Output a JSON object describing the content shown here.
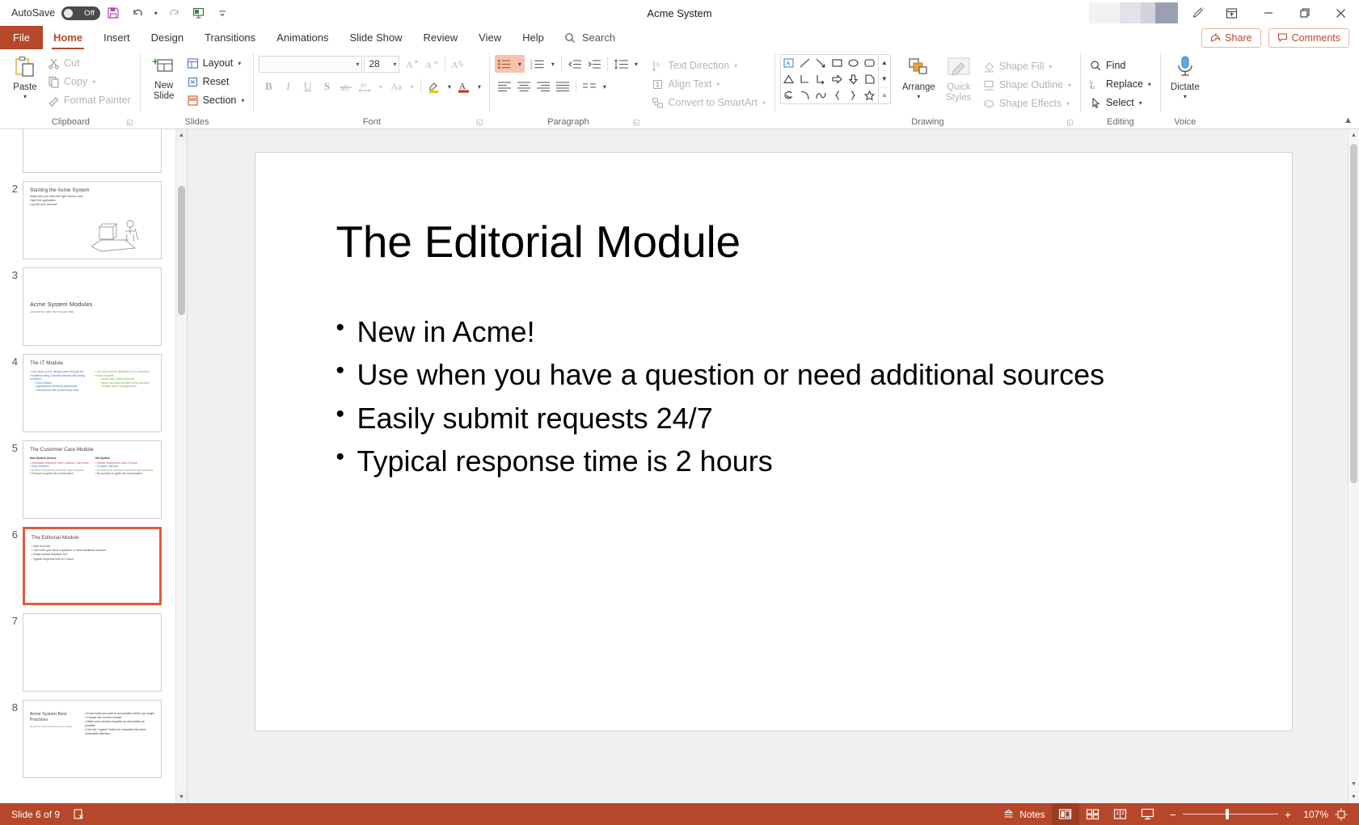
{
  "window": {
    "title": "Acme System",
    "autosave_label": "AutoSave",
    "autosave_state": "Off",
    "minimize": "Minimize",
    "restore": "Restore",
    "close": "Close"
  },
  "quick_access": {
    "save": "save-icon",
    "undo": "undo-icon",
    "redo": "redo-icon",
    "start_slideshow": "slideshow-icon",
    "customize": "customize-qat-icon"
  },
  "tabs": [
    {
      "label": "File",
      "active": false,
      "file": true
    },
    {
      "label": "Home",
      "active": true
    },
    {
      "label": "Insert",
      "active": false
    },
    {
      "label": "Design",
      "active": false
    },
    {
      "label": "Transitions",
      "active": false
    },
    {
      "label": "Animations",
      "active": false
    },
    {
      "label": "Slide Show",
      "active": false
    },
    {
      "label": "Review",
      "active": false
    },
    {
      "label": "View",
      "active": false
    },
    {
      "label": "Help",
      "active": false
    }
  ],
  "search": {
    "label": "Search"
  },
  "titlebar_actions": {
    "share": "Share",
    "comments": "Comments",
    "ribbon_display": "ribbon-display-options-icon",
    "pen": "pen-icon"
  },
  "ribbon": {
    "collapse": "∧",
    "groups": {
      "clipboard": {
        "label": "Clipboard",
        "paste": "Paste",
        "cut": "Cut",
        "copy": "Copy",
        "format_painter": "Format Painter"
      },
      "slides": {
        "label": "Slides",
        "new_slide": "New\nSlide",
        "new_slide_l1": "New",
        "new_slide_l2": "Slide",
        "layout": "Layout",
        "reset": "Reset",
        "section": "Section"
      },
      "font": {
        "label": "Font",
        "font_name": "",
        "font_size": "28",
        "grow": "Increase Font Size",
        "shrink": "Decrease Font Size",
        "clear_formatting": "Clear All Formatting",
        "bold": "B",
        "italic": "I",
        "underline": "U",
        "shadow": "S",
        "strikethrough": "Strikethrough",
        "char_spacing": "Character Spacing",
        "change_case": "Aa",
        "highlight": "Text Highlight Color",
        "font_color": "Font Color"
      },
      "paragraph": {
        "label": "Paragraph",
        "bullets": "Bullets",
        "numbering": "Numbering",
        "decrease_indent": "Decrease List Level",
        "increase_indent": "Increase List Level",
        "line_spacing": "Line Spacing",
        "text_direction": "Text Direction",
        "align_text": "Align Text",
        "convert_smartart": "Convert to SmartArt",
        "align_left": "Align Left",
        "align_center": "Center",
        "align_right": "Align Right",
        "justify": "Justify",
        "columns": "Columns"
      },
      "drawing": {
        "label": "Drawing",
        "arrange": "Arrange",
        "quick_styles_l1": "Quick",
        "quick_styles_l2": "Styles",
        "shape_fill": "Shape Fill",
        "shape_outline": "Shape Outline",
        "shape_effects": "Shape Effects",
        "shapes": [
          "text-box-shape",
          "line-shape",
          "arrow-shape",
          "rectangle-shape",
          "oval-shape",
          "rounded-rectangle-shape",
          "triangle-shape",
          "elbow-connector-shape",
          "elbow-arrow-shape",
          "right-arrow-shape",
          "down-arrow-shape",
          "pentagon-shape",
          "scribble-shape",
          "arc-shape",
          "curve-shape",
          "left-brace-shape",
          "right-brace-shape",
          "star-shape"
        ]
      },
      "editing": {
        "label": "Editing",
        "find": "Find",
        "replace": "Replace",
        "select": "Select"
      },
      "voice": {
        "label": "Voice",
        "dictate": "Dictate"
      }
    }
  },
  "thumbnails": [
    {
      "number": "",
      "selected": false,
      "partial_top": true,
      "title": "",
      "bullets": []
    },
    {
      "number": "2",
      "selected": false,
      "title": "Starting the Acme System",
      "bullets": [
        "Make sure you have the right access code",
        "Open the application",
        "Log into your account"
      ],
      "has_image": true
    },
    {
      "number": "3",
      "selected": false,
      "title": "Acme System Modules",
      "subtitle": "Choose the right one for your task",
      "centered": true,
      "bullets": []
    },
    {
      "number": "4",
      "selected": false,
      "title": "The IT Module",
      "two_col": true,
      "left_items": [
        "Use when you've already gone through the Troubleshooting Checklist and are still having problems:",
        "Slow system",
        "Applications behaving abnormally",
        "Interference with AcmePhone calls"
      ],
      "right_items": [
        "Use when you're following up on a previous service request:",
        "Issue hasn't been resolved",
        "Issue has returned after being resolved",
        "Related issue has appeared"
      ],
      "left_color": "#4472c4",
      "right_color": "#70ad47"
    },
    {
      "number": "5",
      "selected": false,
      "title": "The Customer Care Module",
      "two_col": true,
      "left_header": "New System (Acme)",
      "right_header": "Old System",
      "left_items": [
        "Immediate response from Customer Care team",
        "Easy interface",
        "Access to previous customer care sessions",
        "Prompts to guide the conversation"
      ],
      "right_items": [
        "Submit request and wait 24 hours",
        "Complex interface",
        "No access to previous customer care sessions",
        "No prompts to guide the conversation"
      ],
      "item_colors": [
        "#c0504d",
        "#4472c4",
        "#70ad47",
        "#7030a0"
      ]
    },
    {
      "number": "6",
      "selected": true,
      "title": "The Editorial Module",
      "bullets": [
        "New in Acme!",
        "Use when you have a question or need additional sources",
        "Easily submit requests 24/7",
        "Typical response time is 2 hours"
      ]
    },
    {
      "number": "7",
      "selected": false,
      "title": "",
      "bullets": []
    },
    {
      "number": "8",
      "selected": false,
      "title": "Acme System Best Practices",
      "subtitle": "Read and understand before you begin",
      "two_col": true,
      "right_items": [
        "Know what you want to accomplish before you begin",
        "Choose the correct module",
        "Make your service requests as descriptive as possible",
        "Use the \"urgent\" button for requests that need immediate attention"
      ]
    }
  ],
  "slide": {
    "title": "The Editorial Module",
    "bullets": [
      "New in Acme!",
      "Use when you have a question or need additional sources",
      "Easily submit requests 24/7",
      "Typical response time is 2 hours"
    ]
  },
  "status_bar": {
    "slide_counter": "Slide 6 of 9",
    "accessibility": "accessibility-checker-icon",
    "notes": "Notes",
    "views": [
      {
        "name": "normal-view",
        "active": true
      },
      {
        "name": "slide-sorter-view",
        "active": false
      },
      {
        "name": "reading-view",
        "active": false
      },
      {
        "name": "slide-show-view",
        "active": false
      }
    ],
    "zoom_out": "−",
    "zoom_in": "+",
    "zoom_level": "107%",
    "fit_to_window": "fit-slide-to-window-icon"
  },
  "colors": {
    "accent": "#b7472a",
    "selection": "#e15c38",
    "highlight": "#f6c3ae"
  }
}
